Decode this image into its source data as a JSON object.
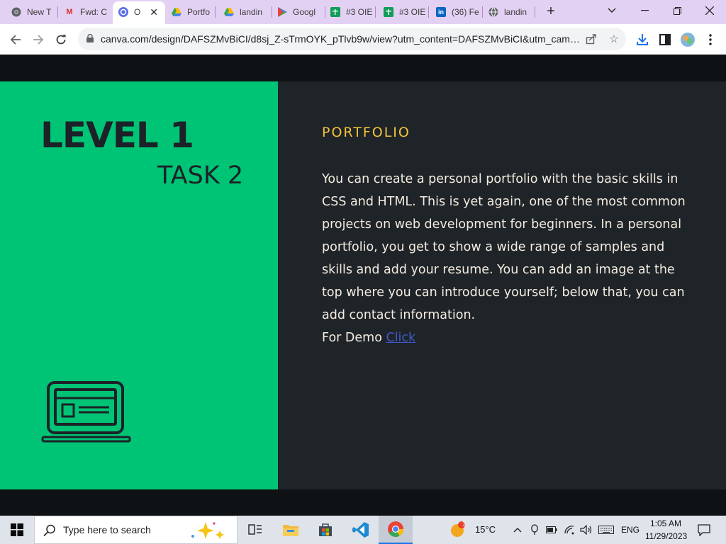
{
  "browser": {
    "tabs": [
      {
        "label": "New T",
        "icon": "chrome-icon"
      },
      {
        "label": "Fwd: C",
        "icon": "gmail-icon"
      },
      {
        "label": "O",
        "icon": "canva-icon",
        "active": true
      },
      {
        "label": "Portfo",
        "icon": "google-drive-icon"
      },
      {
        "label": "landin",
        "icon": "google-drive-icon"
      },
      {
        "label": "Googl",
        "icon": "google-play-icon"
      },
      {
        "label": "#3 OIE",
        "icon": "google-sheets-icon"
      },
      {
        "label": "#3 OIE",
        "icon": "google-sheets-icon"
      },
      {
        "label": "(36) Fe",
        "icon": "linkedin-icon"
      },
      {
        "label": "landin",
        "icon": "globe-icon"
      }
    ],
    "url": "canva.com/design/DAFSZMvBiCI/d8sj_Z-sTrmOYK_pTlvb9w/view?utm_content=DAFSZMvBiCI&utm_campai...",
    "colors": {
      "tabstrip": "#e3d1f3",
      "accent": "#1a73e8"
    }
  },
  "slide": {
    "level": "LEVEL 1",
    "task": "TASK 2",
    "section_title": "PORTFOLIO",
    "body": "You can create a personal portfolio with the basic skills in CSS and HTML. This is yet again, one of the most common projects on web development for beginners. In a personal portfolio, you get to show a wide range of samples and skills and add your resume. You can add an image at the top where you can introduce yourself; below that, you can add contact information.",
    "demo_prefix": "For Demo ",
    "demo_link": "Click",
    "icon": "laptop-icon",
    "colors": {
      "green": "#00c475",
      "dark": "#1f2429",
      "title": "#f5c33b",
      "text": "#f4ece0",
      "link": "#3f59c9"
    }
  },
  "taskbar": {
    "search_placeholder": "Type here to search",
    "weather_temp": "15°C",
    "language": "ENG",
    "time": "1:05 AM",
    "date": "11/29/2023",
    "weather_badge": "1"
  }
}
